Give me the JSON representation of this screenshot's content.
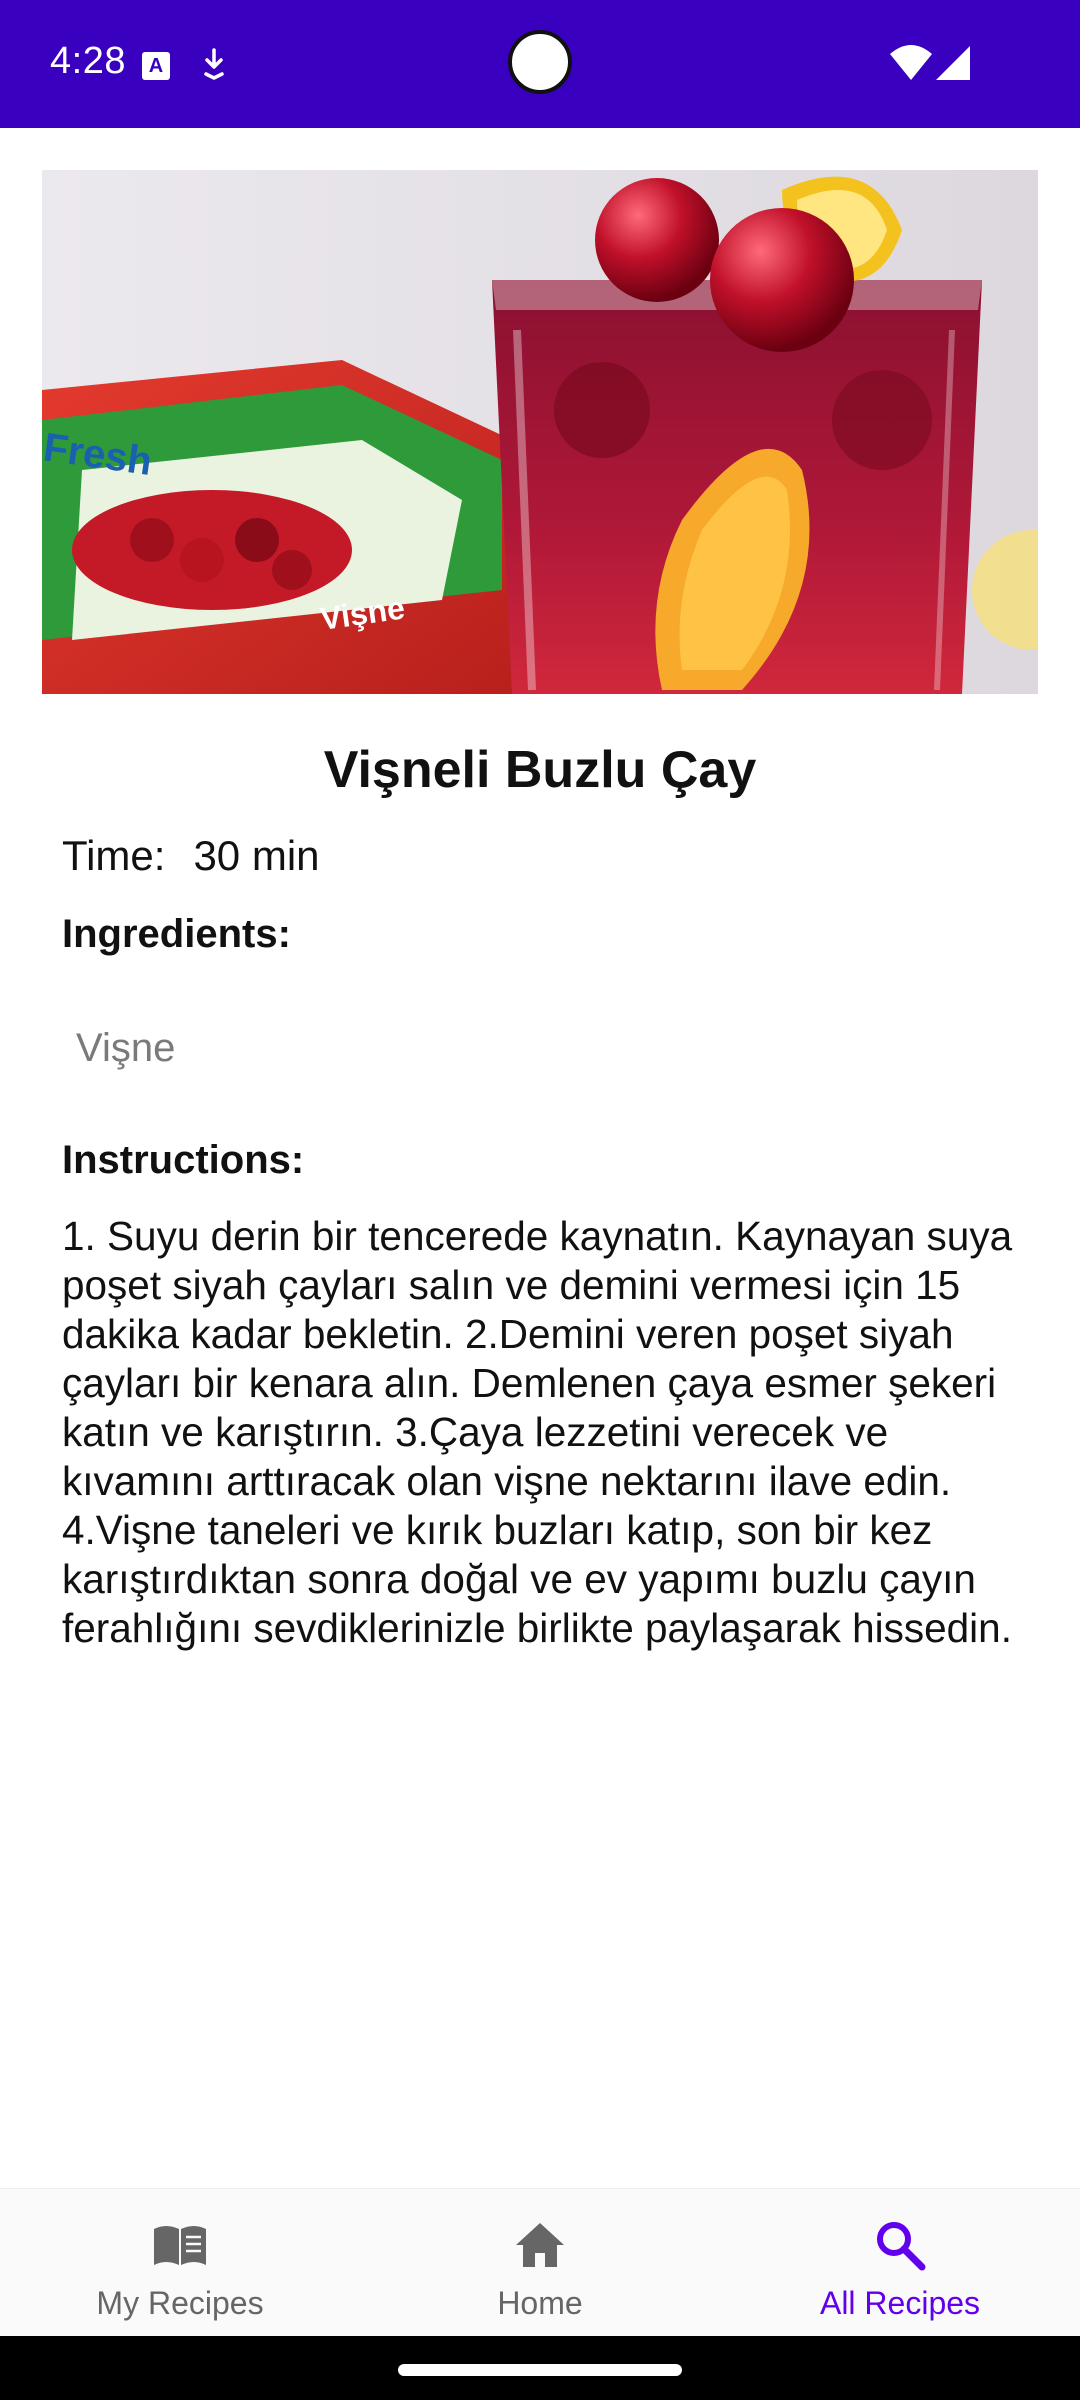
{
  "status_bar": {
    "time": "4:28",
    "background": "#3a00c0"
  },
  "recipe": {
    "image_alt": "Vişneli buzlu çay glass with cherries and lemon",
    "title": "Vişneli Buzlu Çay",
    "time_label": "Time:",
    "time_value": "30 min",
    "ingredients_label": "Ingredients:",
    "ingredients": [
      "Vişne"
    ],
    "instructions_label": "Instructions:",
    "instructions": "1. Suyu derin bir tencerede kaynatın. Kaynayan suya poşet siyah çayları salın ve demini vermesi için 15 dakika kadar bekletin. 2.Demini veren poşet siyah çayları bir kenara alın. Demlenen çaya esmer şekeri katın ve karıştırın. 3.Çaya lezzetini verecek ve kıvamını arttıracak olan vişne nektarını ilave edin. 4.Vişne taneleri ve kırık buzları katıp, son bir kez karıştırdıktan sonra doğal ve ev yapımı buzlu çayın ferahlığını sevdiklerinizle birlikte paylaşarak hissedin."
  },
  "bottom_nav": {
    "items": [
      {
        "label": "My Recipes",
        "icon": "book-icon",
        "active": false
      },
      {
        "label": "Home",
        "icon": "home-icon",
        "active": false
      },
      {
        "label": "All Recipes",
        "icon": "search-icon",
        "active": true
      }
    ],
    "active_color": "#6200ee",
    "inactive_color": "#666666"
  }
}
